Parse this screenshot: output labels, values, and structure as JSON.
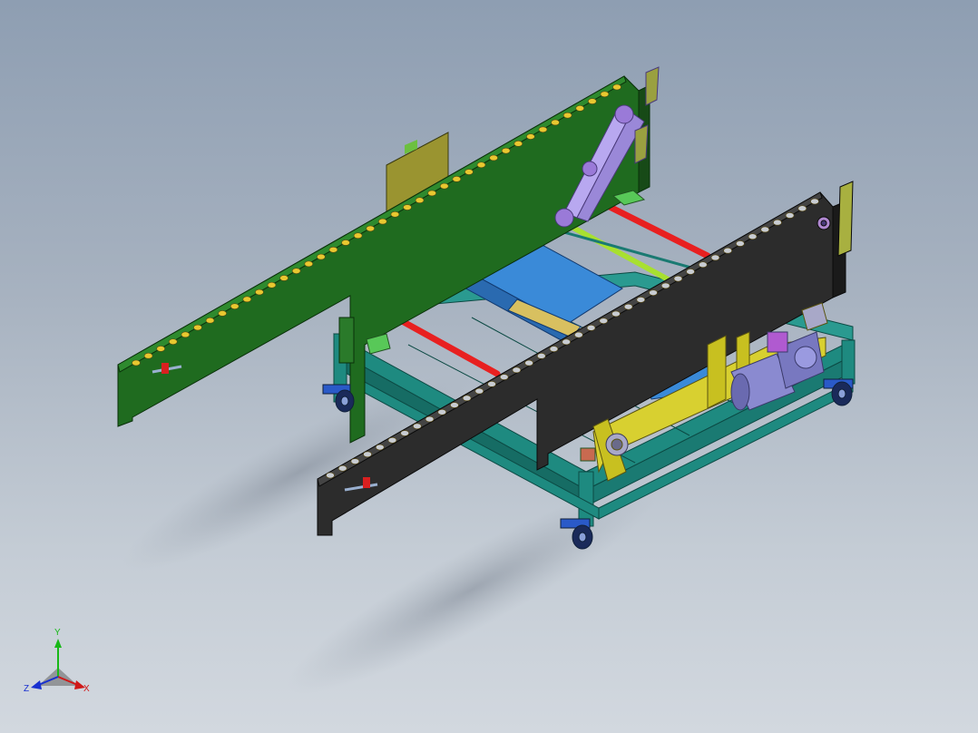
{
  "viewport": {
    "background_top": "#8e9eb2",
    "background_bottom": "#d2d8df"
  },
  "triad": {
    "x_label": "X",
    "y_label": "Y",
    "z_label": "Z",
    "x_color": "#d01818",
    "y_color": "#18b818",
    "z_color": "#1830d0"
  },
  "colors": {
    "frame": "#1e8a80",
    "left_plate": "#1f6b1f",
    "right_plate": "#2c2c2c",
    "roller": "#e8c830",
    "red_shaft": "#e82020",
    "green_shaft": "#a8e030",
    "blue_table": "#3a8ad8",
    "motor": "#8a8ad0",
    "yellow_bracket": "#d8d030",
    "olive_panel": "#a09a30"
  }
}
